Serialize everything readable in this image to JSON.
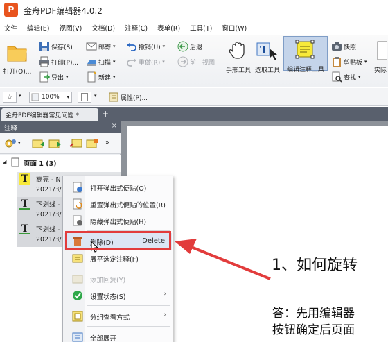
{
  "app": {
    "title": "金舟PDF编辑器4.0.2",
    "icon_letter": "P"
  },
  "menu": [
    "文件",
    "编辑(E)",
    "视图(V)",
    "文档(D)",
    "注释(C)",
    "表单(R)",
    "工具(T)",
    "窗口(W)"
  ],
  "ribbon": {
    "open": "打开(O)...",
    "save": "保存(S)",
    "print": "打印(P)...",
    "export": "导出",
    "email": "邮寄",
    "scan": "扫描",
    "new": "新建",
    "undo": "撤销(U)",
    "redo": "重做(R)",
    "back": "后退",
    "forward": "前一视图",
    "hand_tool": "手形工具",
    "select_tool": "选取工具",
    "edit_annot_tool": "编辑注释工具",
    "snapshot": "快照",
    "clipboard": "剪贴板",
    "find": "查找",
    "actual_size": "实际"
  },
  "toolbar2": {
    "zoom": "100%",
    "properties": "属性(P)..."
  },
  "tab": {
    "label": "金舟PDF编辑器常见问题 *",
    "add": "+"
  },
  "panel": {
    "title": "注释",
    "close": "×",
    "page_node": "页面 1 (3)",
    "annotations": [
      {
        "icon": "T",
        "type": "高亮 - N",
        "date": "2021/3/"
      },
      {
        "icon": "T",
        "type": "下划线 -",
        "date": "2021/3/"
      },
      {
        "icon": "T",
        "type": "下划线 -",
        "date": "2021/3/"
      }
    ]
  },
  "context_menu": {
    "items": [
      {
        "label": "打开弹出式便贴(O)"
      },
      {
        "label": "重置弹出式便贴的位置(R)"
      },
      {
        "label": "隐藏弹出式便贴(H)"
      },
      {
        "label": "删除(D)",
        "shortcut": "Delete"
      },
      {
        "label": "展平选定注释(F)"
      },
      {
        "label": "添加回复(Y)"
      },
      {
        "label": "设置状态(S)",
        "arrow": "›"
      },
      {
        "label": "分组查看方式",
        "arrow": "›"
      },
      {
        "label": "全部展开"
      }
    ]
  },
  "document": {
    "heading": "1、如何旋转",
    "body_line1": "答：先用编辑器",
    "body_line2": "按钮确定后页面"
  },
  "colors": {
    "accent_red": "#e23c3c",
    "tab_dark": "#59606d",
    "highlight_yellow": "#f7e93a"
  }
}
